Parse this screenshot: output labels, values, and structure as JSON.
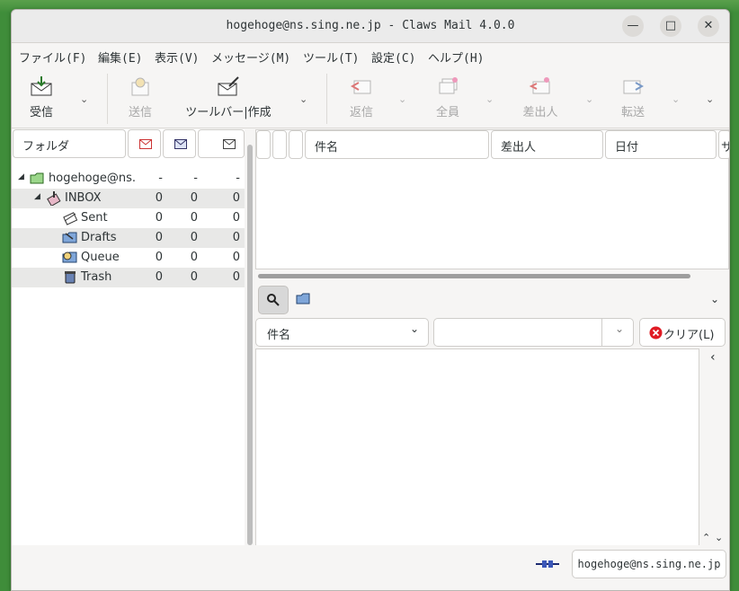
{
  "window": {
    "title": "hogehoge@ns.sing.ne.jp - Claws Mail 4.0.0"
  },
  "menu": [
    "ファイル(F)",
    "編集(E)",
    "表示(V)",
    "メッセージ(M)",
    "ツール(T)",
    "設定(C)",
    "ヘルプ(H)"
  ],
  "toolbar": {
    "receive": "受信",
    "send": "送信",
    "compose": "ツールバー|作成",
    "reply": "返信",
    "reply_all": "全員",
    "reply_sender": "差出人",
    "forward": "転送"
  },
  "folder_pane": {
    "header": "フォルダ",
    "rows": [
      {
        "name": "hogehoge@ns.",
        "new": "-",
        "unread": "-",
        "total": "-",
        "icon": "account-icon"
      },
      {
        "name": "INBOX",
        "new": "0",
        "unread": "0",
        "total": "0",
        "icon": "inbox-icon"
      },
      {
        "name": "Sent",
        "new": "0",
        "unread": "0",
        "total": "0",
        "icon": "sent-icon"
      },
      {
        "name": "Drafts",
        "new": "0",
        "unread": "0",
        "total": "0",
        "icon": "drafts-icon"
      },
      {
        "name": "Queue",
        "new": "0",
        "unread": "0",
        "total": "0",
        "icon": "queue-icon"
      },
      {
        "name": "Trash",
        "new": "0",
        "unread": "0",
        "total": "0",
        "icon": "trash-icon"
      }
    ]
  },
  "message_list": {
    "columns": {
      "subject": "件名",
      "from": "差出人",
      "date": "日付",
      "size": "サ"
    }
  },
  "search": {
    "field_select": "件名",
    "query": "",
    "clear_label": "クリア(L)"
  },
  "status": {
    "account": "hogehoge@ns.sing.ne.jp"
  },
  "colors": {
    "desktop": "#3f8d3a",
    "window_bg": "#f6f5f4",
    "clear_icon": "#e01b24"
  }
}
